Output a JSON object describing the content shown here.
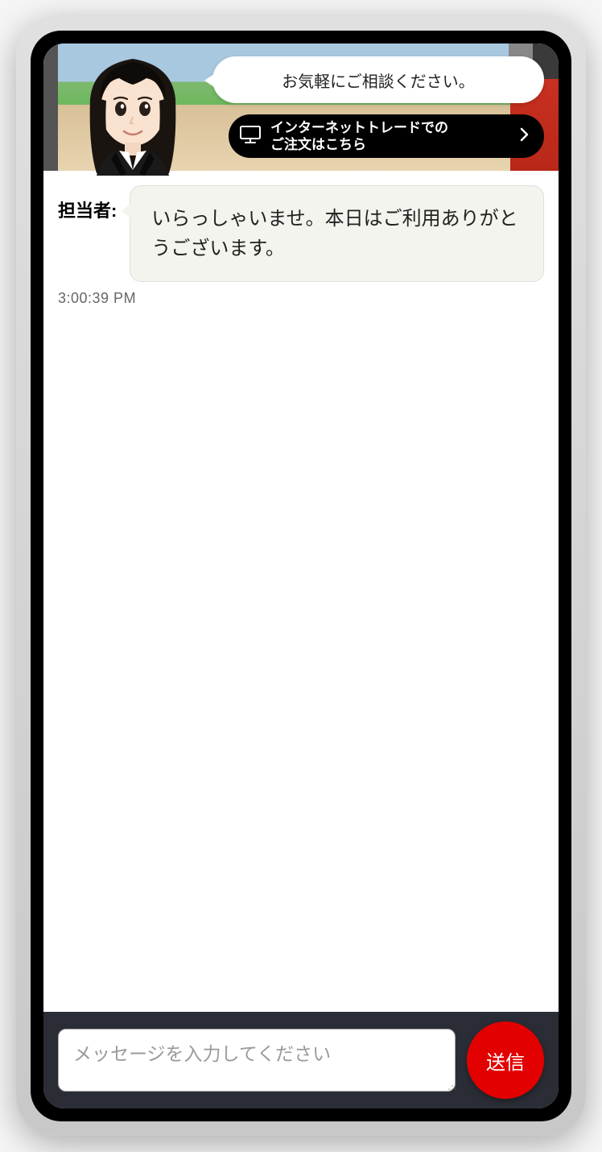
{
  "banner": {
    "speech_text": "お気軽にご相談ください。",
    "cta_line1": "インターネットトレードでの",
    "cta_line2": "ご注文はこちら"
  },
  "chat": {
    "sender_label": "担当者:",
    "message": "いらっしゃいませ。本日はご利用ありがとうございます。",
    "timestamp": "3:00:39 PM"
  },
  "input": {
    "placeholder": "メッセージを入力してください",
    "send_label": "送信"
  }
}
